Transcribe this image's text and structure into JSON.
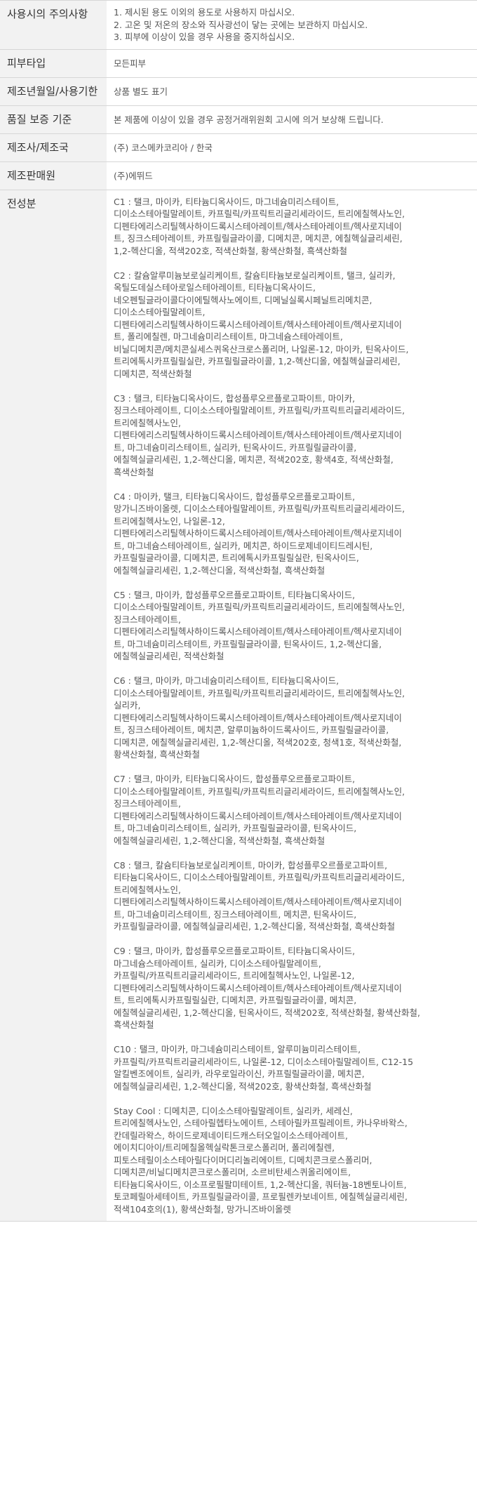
{
  "rows": {
    "precautions": {
      "label": "사용시의 주의사항",
      "lines": [
        "1. 제시된 용도 이외의 용도로 사용하지 마십시오.",
        "2. 고온 및 저온의 장소와 직사광선이 닿는 곳에는 보관하지 마십시오.",
        "3. 피부에 이상이 있을 경우 사용을 중지하십시오."
      ]
    },
    "skin_type": {
      "label": "피부타입",
      "value": "모든피부"
    },
    "manufacture_date": {
      "label": "제조년월일/사용기한",
      "value": "상품 별도 표기"
    },
    "quality": {
      "label": "품질 보증 기준",
      "value": "본 제품에 이상이 있을 경우 공정거래위원회 고시에 의거 보상해 드립니다."
    },
    "manufacturer": {
      "label": "제조사/제조국",
      "value": "(주) 코스메카코리아 / 한국"
    },
    "seller": {
      "label": "제조판매원",
      "value": "(주)에뛰드"
    },
    "ingredients": {
      "label": "전성분",
      "groups": [
        {
          "lines": [
            "C1 : 탤크, 마이카, 티타늄디옥사이드, 마그네슘미리스테이트,",
            "디이소스테아릴말레이트, 카프릴릭/카프릭트리글리세라이드, 트리에칠헥사노인,",
            "디펜타에리스리틸헥사하이드록시스테아레이트/헥사스테아레이트/헥사로지네이",
            "트, 징크스테아레이트, 카프릴릴글라이콜, 디메치콘, 메치콘, 에칠헥실글리세린,",
            "1,2-헥산디올, 적색202호, 적색산화철, 황색산화철, 흑색산화철"
          ]
        },
        {
          "lines": [
            "C2 : 칼슘알루미늄보로실리케이트, 칼슘티타늄보로실리케이트, 탤크, 실리카,",
            "옥틸도데실스테아로일스테아레이트, 티타늄디옥사이드,",
            "네오펜틸글라이콜다이에틸헥사노에이트, 디메닐실록시페닐트리메치콘,",
            "디이소스테아릴말레이트,",
            "디펜타에리스리틸헥사하이드록시스테아레이트/헥사스테아레이트/헥사로지네이",
            "트, 폴리에칠렌, 마그네슘미리스테이트, 마그네슘스테아레이트,",
            "비닐디메치콘/메치콘실세스퀴옥산크로스폴리머, 나일론-12, 마이카, 틴옥사이드,",
            "트리에톡시카프릴릴실란, 카프릴릴글라이콜, 1,2-헥산디올, 에칠헥실글리세린,",
            "디메치콘, 적색산화철"
          ]
        },
        {
          "lines": [
            "C3 : 탤크, 티타늄디옥사이드, 합성플루오르플로고파이트, 마이카,",
            "징크스테아레이트, 디이소스테아릴말레이트, 카프릴릭/카프릭트리글리세라이드,",
            "트리에칠헥사노인,",
            "디펜타에리스리틸헥사하이드록시스테아레이트/헥사스테아레이트/헥사로지네이",
            "트, 마그네슘미리스테이트, 실리카, 틴옥사이드, 카프릴릴글라이콜,",
            "에칠헥실글리세린, 1,2-헥산디올, 메치콘, 적색202호, 황색4호, 적색산화철,",
            "흑색산화철"
          ]
        },
        {
          "lines": [
            "C4 : 마이카, 탤크, 티타늄디옥사이드, 합성플루오르플로고파이트,",
            "망가니즈바이올렛, 디이소스테아릴말레이트, 카프릴릭/카프릭트리글리세라이드,",
            "트리에칠헥사노인, 나일론-12,",
            "디펜타에리스리틸헥사하이드록시스테아레이트/헥사스테아레이트/헥사로지네이",
            "트, 마그네슘스테아레이트, 실리카, 메치콘, 하이드로제네이티드레시틴,",
            "카프릴릴글라이콜, 디메치콘, 트리에톡시카프릴릴실란, 틴옥사이드,",
            "에칠헥실글리세린, 1,2-헥산디올, 적색산화철, 흑색산화철"
          ]
        },
        {
          "lines": [
            "C5 : 탤크, 마이카, 합성플루오르플로고파이트, 티타늄디옥사이드,",
            "디이소스테아릴말레이트, 카프릴릭/카프릭트리글리세라이드, 트리에칠헥사노인,",
            "징크스테아레이트,",
            "디펜타에리스리틸헥사하이드록시스테아레이트/헥사스테아레이트/헥사로지네이",
            "트, 마그네슘미리스테이트, 카프릴릴글라이콜, 틴옥사이드, 1,2-헥산디올,",
            "에칠헥실글리세린, 적색산화철"
          ]
        },
        {
          "lines": [
            "C6 : 탤크, 마이카, 마그네슘미리스테이트, 티타늄디옥사이드,",
            "디이소스테아릴말레이트, 카프릴릭/카프릭트리글리세라이드, 트리에칠헥사노인,",
            "실리카,",
            "디펜타에리스리틸헥사하이드록시스테아레이트/헥사스테아레이트/헥사로지네이",
            "트, 징크스테아레이트, 메치콘, 알루미늄하이드록사이드, 카프릴릴글라이콜,",
            "디메치콘, 에칠헥실글리세린, 1,2-헥산디올, 적색202호, 청색1호, 적색산화철,",
            "황색산화철, 흑색산화철"
          ]
        },
        {
          "lines": [
            "C7 : 탤크, 마이카, 티타늄디옥사이드, 합성플루오르플로고파이트,",
            "디이소스테아릴말레이트, 카프릴릭/카프릭트리글리세라이드, 트리에칠헥사노인,",
            "징크스테아레이트,",
            "디펜타에리스리틸헥사하이드록시스테아레이트/헥사스테아레이트/헥사로지네이",
            "트, 마그네슘미리스테이트, 실리카, 카프릴릴글라이콜, 틴옥사이드,",
            "에칠헥실글리세린, 1,2-헥산디올, 적색산화철, 흑색산화철"
          ]
        },
        {
          "lines": [
            "C8 : 탤크, 칼슘티타늄보로실리케이트, 마이카, 합성플루오르플로고파이트,",
            "티타늄디옥사이드, 디이소스테아릴말레이트, 카프릴릭/카프릭트리글리세라이드,",
            "트리에칠헥사노인,",
            "디펜타에리스리틸헥사하이드록시스테아레이트/헥사스테아레이트/헥사로지네이",
            "트, 마그네슘미리스테이트, 징크스테아레이트, 메치콘, 틴옥사이드,",
            "카프릴릴글라이콜, 에칠헥실글리세린, 1,2-헥산디올, 적색산화철, 흑색산화철"
          ]
        },
        {
          "lines": [
            "C9 : 탤크, 마이카, 합성플루오르플로고파이트, 티타늄디옥사이드,",
            "마그네슘스테아레이트, 실리카, 디이소스테아릴말레이트,",
            "카프릴릭/카프릭트리글리세라이드, 트리에칠헥사노인, 나일론-12,",
            "디펜타에리스리틸헥사하이드록시스테아레이트/헥사스테아레이트/헥사로지네이",
            "트, 트리에톡시카프릴릴실란, 디메치콘, 카프릴릴글라이콜, 메치콘,",
            "에칠헥실글리세린, 1,2-헥산디올, 틴옥사이드, 적색202호, 적색산화철, 황색산화철,",
            "흑색산화철"
          ]
        },
        {
          "lines": [
            "C10 : 탤크, 마이카, 마그네슘미리스테이트, 알루미늄미리스테이트,",
            "카프릴릭/카프릭트리글리세라이드, 나일론-12, 디이소스테아릴말레이트, C12-15",
            "알킬벤조에이트, 실리카, 라우로일라이신, 카프릴릴글라이콜, 메치콘,",
            "에칠헥실글리세린, 1,2-헥산디올, 적색202호, 황색산화철, 흑색산화철"
          ]
        },
        {
          "lines": [
            "Stay Cool : 디메치콘, 디이소스테아릴말레이트, 실리카, 세레신,",
            "트리에칠헥사노인, 스테아릴헵타노에이트, 스테아릴카프릴레이트, 카나우바왁스,",
            "칸데릴라왁스, 하이드로제네이티드캐스터오일이소스테아레이트,",
            "에이치디아이/트리메칠올헥실락톤크로스폴리머, 폴리에칠렌,",
            "피토스테릴이소스테아릴다이머디리놀리에이트, 디메치콘크로스폴리머,",
            "디메치콘/비닐디메치콘크로스폴리머, 소르비탄세스퀴올리에이트,",
            "티타늄디옥사이드, 이소프로필팔미테이트, 1,2-헥산디올, 쿼터늄-18벤토나이트,",
            "토코페릴아세테이트, 카프릴릴글라이콜, 프로필렌카보네이트, 에칠헥실글리세린,",
            "적색104호의(1), 황색산화철, 망가니즈바이올렛"
          ]
        }
      ]
    }
  }
}
